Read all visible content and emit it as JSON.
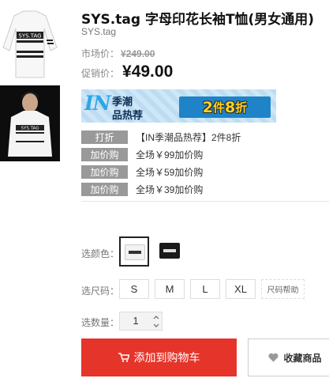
{
  "product": {
    "title": "SYS.tag 字母印花长袖T恤(男女通用)",
    "brand": "SYS.tag",
    "market_label": "市场价：",
    "market_price": "¥249.00",
    "promo_label": "促销价：",
    "promo_price": "¥49.00"
  },
  "thumbnails": [
    {
      "name": "thumb-white-tee",
      "print": "SYS.TAG"
    },
    {
      "name": "thumb-model-photo",
      "print": "SYS.TAG"
    }
  ],
  "banner": {
    "logo": "IN",
    "line1": "季潮",
    "line2": "品热荐",
    "offer_num1": "2",
    "offer_word1": "件",
    "offer_num2": "8",
    "offer_word2": "折"
  },
  "promotions": [
    {
      "badge": "打折",
      "text": "【IN季潮品热荐】2件8折"
    },
    {
      "badge": "加价购",
      "text": "全场￥99加价购"
    },
    {
      "badge": "加价购",
      "text": "全场￥59加价购"
    },
    {
      "badge": "加价购",
      "text": "全场￥39加价购"
    }
  ],
  "options": {
    "color_label": "选颜色：",
    "colors": [
      {
        "name": "white",
        "selected": true
      },
      {
        "name": "black",
        "selected": false
      }
    ],
    "size_label": "选尺码：",
    "sizes": [
      "S",
      "M",
      "L",
      "XL"
    ],
    "size_help": "尺码帮助",
    "qty_label": "选数量：",
    "qty_value": "1"
  },
  "actions": {
    "add_to_cart": "添加到购物车",
    "favorite": "收藏商品"
  },
  "colors": {
    "accent": "#e5342a",
    "badge_gray": "#999999",
    "banner_blue": "#1f83c8",
    "banner_yellow": "#ffd21f"
  },
  "icons": [
    "cart-icon",
    "heart-icon",
    "chevron-up-icon",
    "chevron-down-icon"
  ]
}
